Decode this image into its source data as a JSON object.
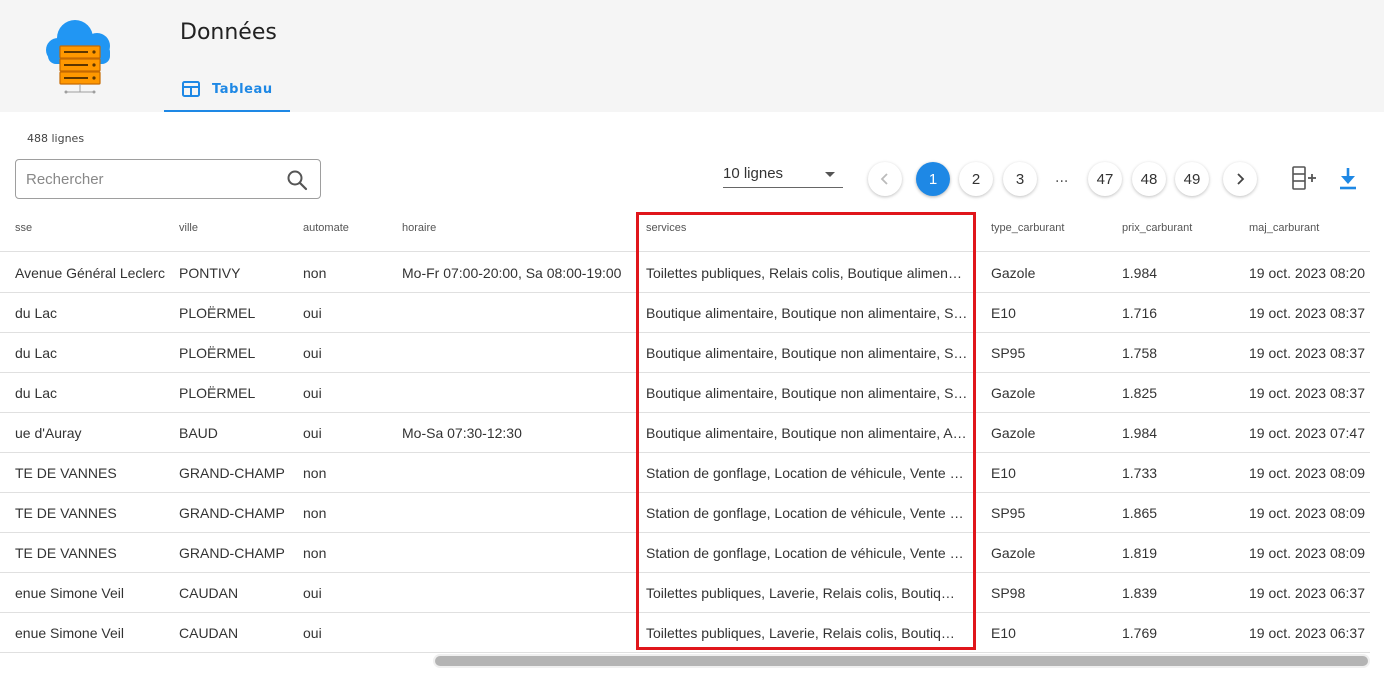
{
  "header": {
    "title": "Données",
    "tab_label": "Tableau"
  },
  "toolbar": {
    "row_count": "488 lignes",
    "search_placeholder": "Rechercher",
    "lines_per_page": "10 lignes",
    "pages": [
      "1",
      "2",
      "3",
      "47",
      "48",
      "49"
    ],
    "ellipsis": "...",
    "current_page": "1"
  },
  "table": {
    "headers": {
      "adresse": "sse",
      "ville": "ville",
      "automate": "automate",
      "horaire": "horaire",
      "services": "services",
      "type_carburant": "type_carburant",
      "prix_carburant": "prix_carburant",
      "maj_carburant": "maj_carburant"
    },
    "rows": [
      {
        "adresse": "Avenue Général Leclerc",
        "ville": "PONTIVY",
        "automate": "non",
        "horaire": "Mo-Fr 07:00-20:00, Sa 08:00-19:00",
        "services": "Toilettes publiques, Relais colis, Boutique alimen…",
        "type_carburant": "Gazole",
        "prix_carburant": "1.984",
        "maj_carburant": "19 oct. 2023 08:20"
      },
      {
        "adresse": "du Lac",
        "ville": "PLOËRMEL",
        "automate": "oui",
        "horaire": "",
        "services": "Boutique alimentaire, Boutique non alimentaire, St…",
        "type_carburant": "E10",
        "prix_carburant": "1.716",
        "maj_carburant": "19 oct. 2023 08:37"
      },
      {
        "adresse": "du Lac",
        "ville": "PLOËRMEL",
        "automate": "oui",
        "horaire": "",
        "services": "Boutique alimentaire, Boutique non alimentaire, St…",
        "type_carburant": "SP95",
        "prix_carburant": "1.758",
        "maj_carburant": "19 oct. 2023 08:37"
      },
      {
        "adresse": "du Lac",
        "ville": "PLOËRMEL",
        "automate": "oui",
        "horaire": "",
        "services": "Boutique alimentaire, Boutique non alimentaire, St…",
        "type_carburant": "Gazole",
        "prix_carburant": "1.825",
        "maj_carburant": "19 oct. 2023 08:37"
      },
      {
        "adresse": "ue d'Auray",
        "ville": "BAUD",
        "automate": "oui",
        "horaire": "Mo-Sa 07:30-12:30",
        "services": "Boutique alimentaire, Boutique non alimentaire, Au…",
        "type_carburant": "Gazole",
        "prix_carburant": "1.984",
        "maj_carburant": "19 oct. 2023 07:47"
      },
      {
        "adresse": "TE DE VANNES",
        "ville": "GRAND-CHAMP",
        "automate": "non",
        "horaire": "",
        "services": "Station de gonflage, Location de véhicule, Vente d…",
        "type_carburant": "E10",
        "prix_carburant": "1.733",
        "maj_carburant": "19 oct. 2023 08:09"
      },
      {
        "adresse": "TE DE VANNES",
        "ville": "GRAND-CHAMP",
        "automate": "non",
        "horaire": "",
        "services": "Station de gonflage, Location de véhicule, Vente d…",
        "type_carburant": "SP95",
        "prix_carburant": "1.865",
        "maj_carburant": "19 oct. 2023 08:09"
      },
      {
        "adresse": "TE DE VANNES",
        "ville": "GRAND-CHAMP",
        "automate": "non",
        "horaire": "",
        "services": "Station de gonflage, Location de véhicule, Vente d…",
        "type_carburant": "Gazole",
        "prix_carburant": "1.819",
        "maj_carburant": "19 oct. 2023 08:09"
      },
      {
        "adresse": "enue Simone Veil",
        "ville": "CAUDAN",
        "automate": "oui",
        "horaire": "",
        "services": "Toilettes publiques, Laverie, Relais colis, Boutiq…",
        "type_carburant": "SP98",
        "prix_carburant": "1.839",
        "maj_carburant": "19 oct. 2023 06:37"
      },
      {
        "adresse": "enue Simone Veil",
        "ville": "CAUDAN",
        "automate": "oui",
        "horaire": "",
        "services": "Toilettes publiques, Laverie, Relais colis, Boutiq…",
        "type_carburant": "E10",
        "prix_carburant": "1.769",
        "maj_carburant": "19 oct. 2023 06:37"
      }
    ]
  },
  "icons": {
    "logo": "cloud-server-logo",
    "tab": "table-icon",
    "search": "search-icon",
    "prev": "chevron-left-icon",
    "next": "chevron-right-icon",
    "add_column": "add-column-icon",
    "download": "download-icon"
  },
  "colors": {
    "accent": "#1e88e5",
    "highlight": "#e0161b",
    "logo_cloud": "#2196f3",
    "logo_server": "#ff9800"
  }
}
